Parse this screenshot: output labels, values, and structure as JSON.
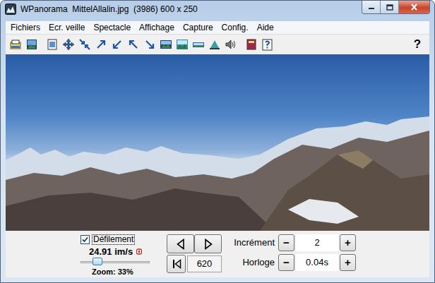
{
  "window": {
    "title": "WPanorama  MittelAllalin.jpg  (3986) 600 x 250"
  },
  "menu": [
    {
      "label": "Fichiers"
    },
    {
      "label": "Ecr. veille"
    },
    {
      "label": "Spectacle"
    },
    {
      "label": "Affichage"
    },
    {
      "label": "Capture"
    },
    {
      "label": "Config."
    },
    {
      "label": "Aide"
    }
  ],
  "toolbar": {
    "help": "?"
  },
  "controls": {
    "scroll": {
      "label": "Défilement",
      "checked": true
    },
    "rate": "24.91 im/s",
    "zoom": {
      "label": "Zoom: 33%",
      "level": 0.2
    },
    "position": "620",
    "steppers": [
      {
        "label": "Incrément",
        "value": "2",
        "minus": "−",
        "plus": "+"
      },
      {
        "label": "Horloge",
        "value": "0.04s",
        "minus": "−",
        "plus": "+"
      }
    ]
  }
}
